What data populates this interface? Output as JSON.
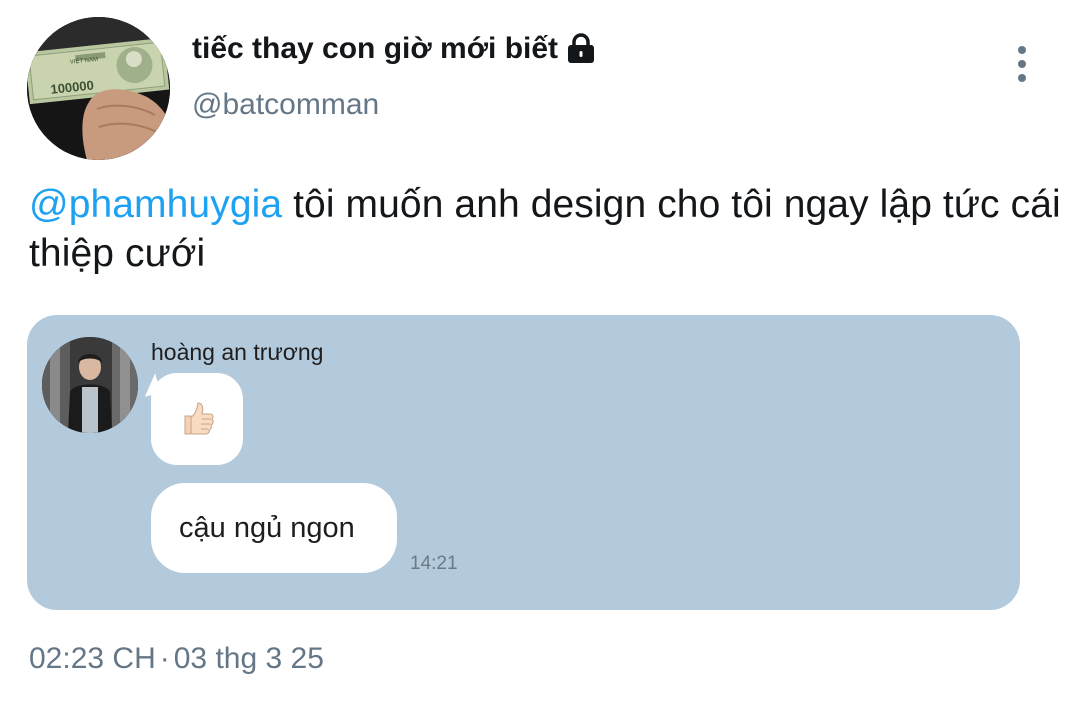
{
  "tweet": {
    "display_name": "tiếc thay con giờ mới biết",
    "handle": "@batcomman",
    "mention": "@phamhuygia",
    "text": " tôi muốn anh design cho tôi ngay lập tức cái thiệp cưới",
    "avatar_banknote_value": "100000",
    "avatar_banknote_country": "VIỆT NAM",
    "time": "02:23 CH",
    "separator": "·",
    "date": "03 thg 3 25"
  },
  "media": {
    "sender_name": "hoàng an trương",
    "message_1_emoji": "👍",
    "message_2_text": "cậu ngủ ngon",
    "message_time": "14:21"
  },
  "colors": {
    "mention": "#1da1f2",
    "secondary_text": "#657786",
    "media_background": "#b3c9dc",
    "bubble": "#ffffff"
  },
  "icons": {
    "lock": "lock-icon",
    "more": "more-vertical-icon"
  }
}
